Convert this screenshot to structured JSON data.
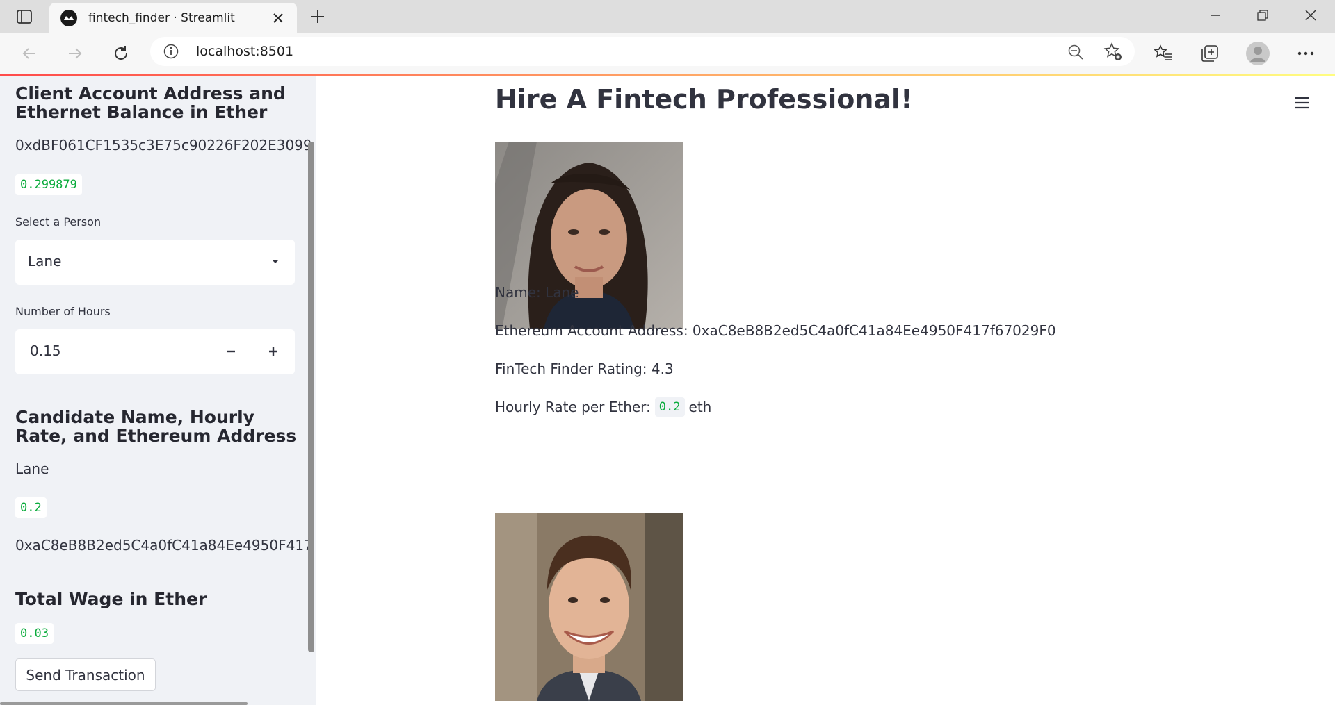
{
  "browser": {
    "tab_title": "fintech_finder · Streamlit",
    "url": "localhost:8501"
  },
  "colors": {
    "accent_red": "#ff4b4b",
    "code_green": "#09ab3b",
    "sidebar_bg": "#f0f2f6",
    "text": "#31333f"
  },
  "sidebar": {
    "account_heading": "Client Account Address and Ethernet Balance in Ether",
    "account_address": "0xdBF061CF1535c3E75c90226F202E3099",
    "balance": "0.299879",
    "select_label": "Select a Person",
    "select_value": "Lane",
    "hours_label": "Number of Hours",
    "hours_value": "0.15",
    "decrement_symbol": "−",
    "increment_symbol": "+",
    "candidate_heading": "Candidate Name, Hourly Rate, and Ethereum Address",
    "candidate_name": "Lane",
    "candidate_rate": "0.2",
    "candidate_address": "0xaC8eB8B2ed5C4a0fC41a84Ee4950F417",
    "wage_heading": "Total Wage in Ether",
    "wage_value": "0.03",
    "send_button": "Send Transaction"
  },
  "main": {
    "title": "Hire A Fintech Professional!",
    "candidates": [
      {
        "name_line": "Name: Lane",
        "address_line": "Ethereum Account Address: 0xaC8eB8B2ed5C4a0fC41a84Ee4950F417f67029F0",
        "rating_line": "FinTech Finder Rating: 4.3",
        "rate_prefix": "Hourly Rate per Ether:",
        "rate_value": "0.2",
        "rate_suffix": "eth"
      }
    ]
  }
}
